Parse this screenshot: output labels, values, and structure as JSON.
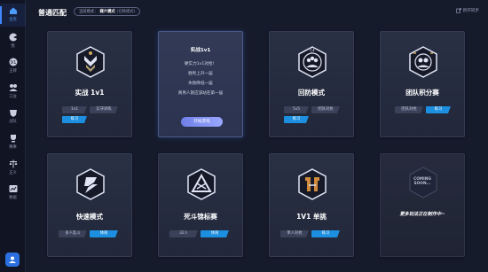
{
  "sidebar": {
    "items": [
      {
        "label": "主页",
        "icon": "home-icon",
        "active": true
      },
      {
        "label": "我",
        "icon": "profile-icon",
        "active": false
      },
      {
        "label": "王牌",
        "icon": "ace-icon",
        "active": false
      },
      {
        "label": "工会",
        "icon": "guild-icon",
        "active": false
      },
      {
        "label": "战队",
        "icon": "team-icon",
        "active": false
      },
      {
        "label": "赛事",
        "icon": "trophy-icon",
        "active": false
      },
      {
        "label": "正义",
        "icon": "justice-icon",
        "active": false
      },
      {
        "label": "数据",
        "icon": "data-icon",
        "active": false
      }
    ],
    "bottom_icon": "user-settings-icon"
  },
  "header": {
    "title": "普通匹配",
    "mode_label": "当前模式：",
    "mode_value": "媒介模式",
    "mode_sub": "(切换模式)",
    "new_sync": "新开同步"
  },
  "cards": {
    "combat": {
      "title": "实战 1v1",
      "tags": [
        "1v1",
        "实守训练",
        "练习"
      ],
      "icon": "combat-badge-icon"
    },
    "solo": {
      "title": "实战1v1",
      "lines": [
        "硬实力1v1对抢！",
        "胜利上升一届",
        "失败降低一届",
        "真男人就应该站在第一届"
      ],
      "button": "开始游戏",
      "icon": "none"
    },
    "defense": {
      "title": "回防模式",
      "tags": [
        "5v5",
        "团队对抗",
        "练习"
      ],
      "icon": "defense-badge-icon"
    },
    "team": {
      "title": "团队积分赛",
      "tags": [
        "团队对抗",
        "练习"
      ],
      "icon": "team-score-badge-icon"
    },
    "quick": {
      "title": "快速模式",
      "tags": [
        "多人乱斗",
        "休闲"
      ],
      "icon": "quick-badge-icon"
    },
    "deathmatch": {
      "title": "死斗锦标赛",
      "tags": [
        "32人",
        "休闲"
      ],
      "icon": "deathmatch-badge-icon"
    },
    "single": {
      "title": "1V1 单挑",
      "tags": [
        "单人对抗",
        "练习"
      ],
      "icon": "duel-badge-icon"
    },
    "coming": {
      "badge": "COMING SOON...",
      "text": "更多玩法正在制作中~",
      "icon": "coming-soon-badge-icon"
    }
  },
  "colors": {
    "accent": "#1c8fe0",
    "background": "#161b2c",
    "card": "#262c40",
    "button": "#8090f0"
  }
}
